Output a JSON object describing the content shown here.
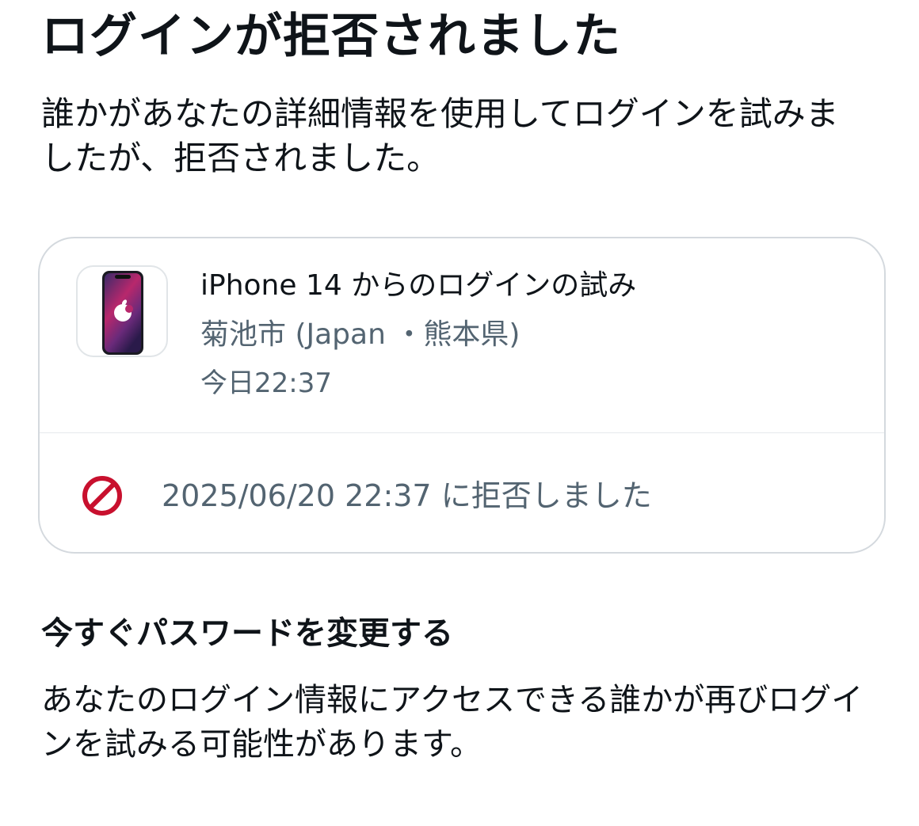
{
  "title": "ログインが拒否されました",
  "intro": "誰かがあなたの詳細情報を使用してログインを試みましたが、拒否されました。",
  "login_attempt": {
    "device_icon": "iphone-device-icon",
    "device_name": "iPhone 14 からのログインの試み",
    "location": "菊池市 (Japan ・熊本県)",
    "time": "今日22:37",
    "status_icon": "prohibited-icon",
    "status_text": "2025/06/20 22:37 に拒否しました"
  },
  "password_section": {
    "heading": "今すぐパスワードを変更する",
    "body": "あなたのログイン情報にアクセスできる誰かが再びログインを試みる可能性があります。"
  },
  "colors": {
    "text_primary": "#0f1419",
    "text_secondary": "#536471",
    "card_border": "#d4d9de",
    "denied_red": "#c8102e"
  }
}
